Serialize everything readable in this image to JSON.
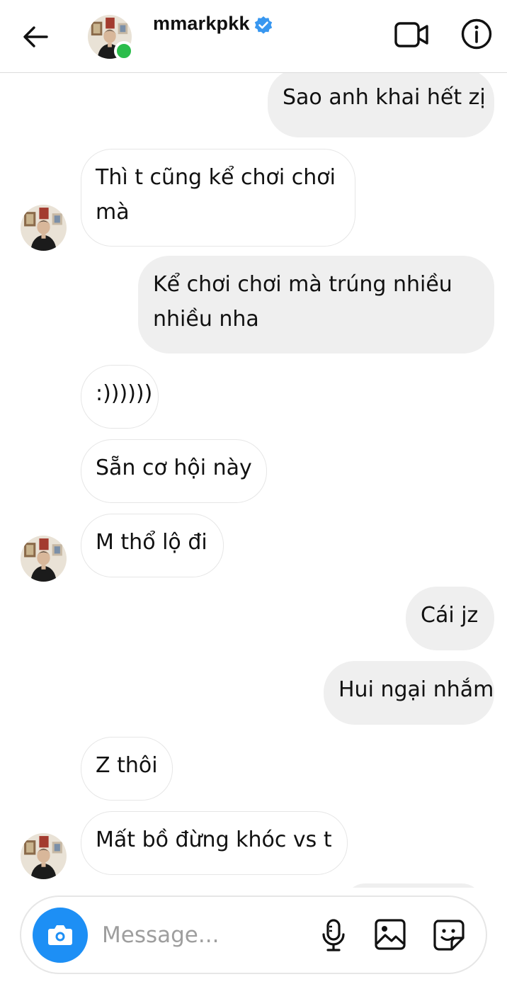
{
  "header": {
    "username": "mmarkpkk",
    "verified": true,
    "online": true,
    "icons": [
      "back-arrow-icon",
      "verified-badge-icon",
      "video-call-icon",
      "info-icon"
    ]
  },
  "messages": [
    {
      "direction": "outgoing",
      "lines": [
        "Sao anh khai hết zị"
      ]
    },
    {
      "direction": "incoming",
      "lines": [
        "Thì t cũng kể chơi chơi",
        "mà"
      ],
      "show_avatar": true
    },
    {
      "direction": "outgoing",
      "lines": [
        "Kể chơi chơi mà trúng nhiều",
        "nhiều nha"
      ]
    },
    {
      "direction": "incoming",
      "lines": [
        ":))))))"
      ]
    },
    {
      "direction": "incoming",
      "lines": [
        "Sẵn cơ hội này"
      ]
    },
    {
      "direction": "incoming",
      "lines": [
        "M thổ lộ đi"
      ],
      "show_avatar": true
    },
    {
      "direction": "outgoing",
      "lines": [
        "Cái jz"
      ]
    },
    {
      "direction": "outgoing",
      "lines": [
        "Hui ngại nhắm"
      ]
    },
    {
      "direction": "incoming",
      "lines": [
        "Z thôi"
      ]
    },
    {
      "direction": "incoming",
      "lines": [
        "Mất bồ đừng khóc vs t"
      ],
      "show_avatar": true
    }
  ],
  "composer": {
    "placeholder": "Message...",
    "icons": [
      "camera-icon",
      "microphone-icon",
      "gallery-icon",
      "sticker-icon"
    ]
  },
  "colors": {
    "accent_blue": "#1d8ff5",
    "online_green": "#2bbd4b",
    "outgoing_bubble": "#efefef",
    "incoming_border": "#e6e6e6"
  }
}
